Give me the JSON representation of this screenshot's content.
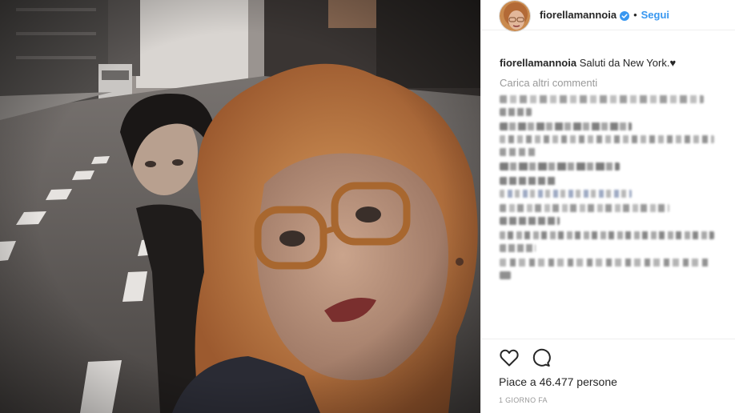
{
  "post": {
    "username": "fiorellamannoia",
    "separator": "•",
    "follow_label": "Segui",
    "caption_username": "fiorellamannoia",
    "caption_text": "Saluti da New York.",
    "caption_heart": "♥",
    "load_more_label": "Carica altri commenti",
    "likes_text": "Piace a 46.477 persone",
    "timestamp": "1 GIORNO FA"
  },
  "icons": {
    "verified": "verified-badge-icon",
    "like": "heart-outline-icon",
    "comment": "comment-bubble-icon"
  },
  "colors": {
    "link_blue": "#3897f0",
    "muted_grey": "#999999",
    "text_dark": "#262626",
    "divider": "#efefef"
  }
}
